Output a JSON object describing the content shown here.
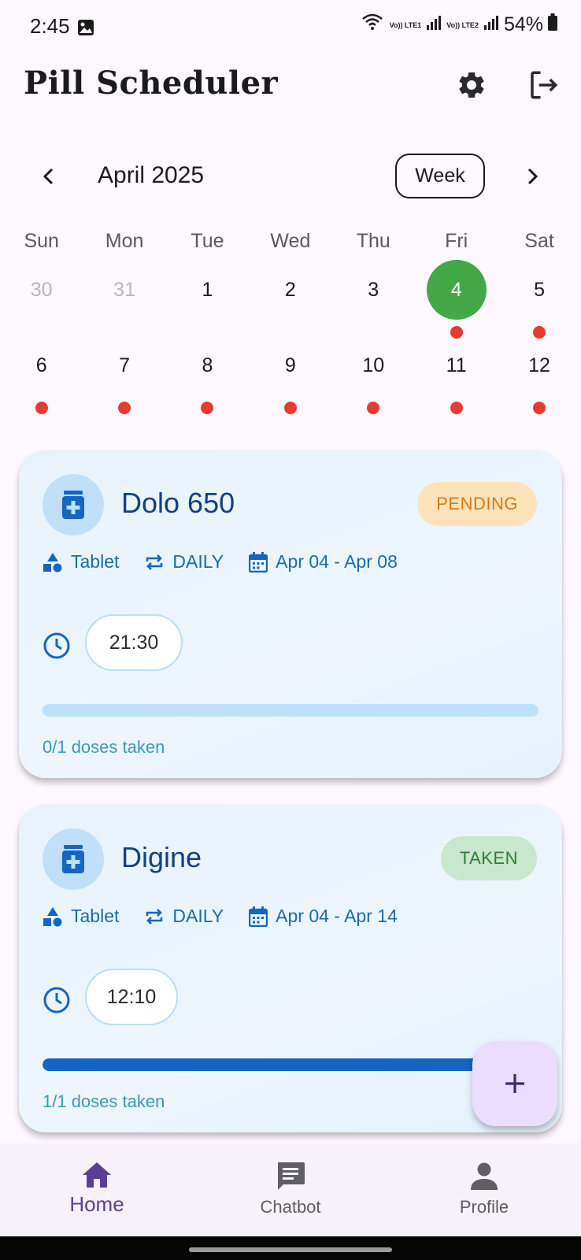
{
  "status_bar": {
    "time": "2:45",
    "net1": "Vo)) LTE1",
    "net2": "Vo)) LTE2",
    "battery": "54%"
  },
  "header": {
    "title": "Pill  Scheduler"
  },
  "calendar": {
    "month": "April 2025",
    "view_toggle": "Week",
    "weekdays": [
      "Sun",
      "Mon",
      "Tue",
      "Wed",
      "Thu",
      "Fri",
      "Sat"
    ],
    "week1": [
      "30",
      "31",
      "1",
      "2",
      "3",
      "4",
      "5"
    ],
    "week2": [
      "6",
      "7",
      "8",
      "9",
      "10",
      "11",
      "12"
    ],
    "selected_day": "4"
  },
  "medications": [
    {
      "name": "Dolo 650",
      "status": "PENDING",
      "form": "Tablet",
      "frequency": "DAILY",
      "date_range": "Apr 04 - Apr 08",
      "time": "21:30",
      "doses_text": "0/1 doses taken",
      "progress": 0
    },
    {
      "name": "Digine",
      "status": "TAKEN",
      "form": "Tablet",
      "frequency": "DAILY",
      "date_range": "Apr 04 - Apr 14",
      "time": "12:10",
      "doses_text": "1/1 doses taken",
      "progress": 1
    }
  ],
  "fab": {
    "icon": "plus-icon"
  },
  "bottom_nav": [
    {
      "label": "Home",
      "icon": "home-icon",
      "active": true
    },
    {
      "label": "Chatbot",
      "icon": "chat-icon",
      "active": false
    },
    {
      "label": "Profile",
      "icon": "person-icon",
      "active": false
    }
  ],
  "colors": {
    "accent": "#5b3f96",
    "selected_day": "#43a848",
    "dot": "#e63b30",
    "progress": "#1466c0"
  }
}
